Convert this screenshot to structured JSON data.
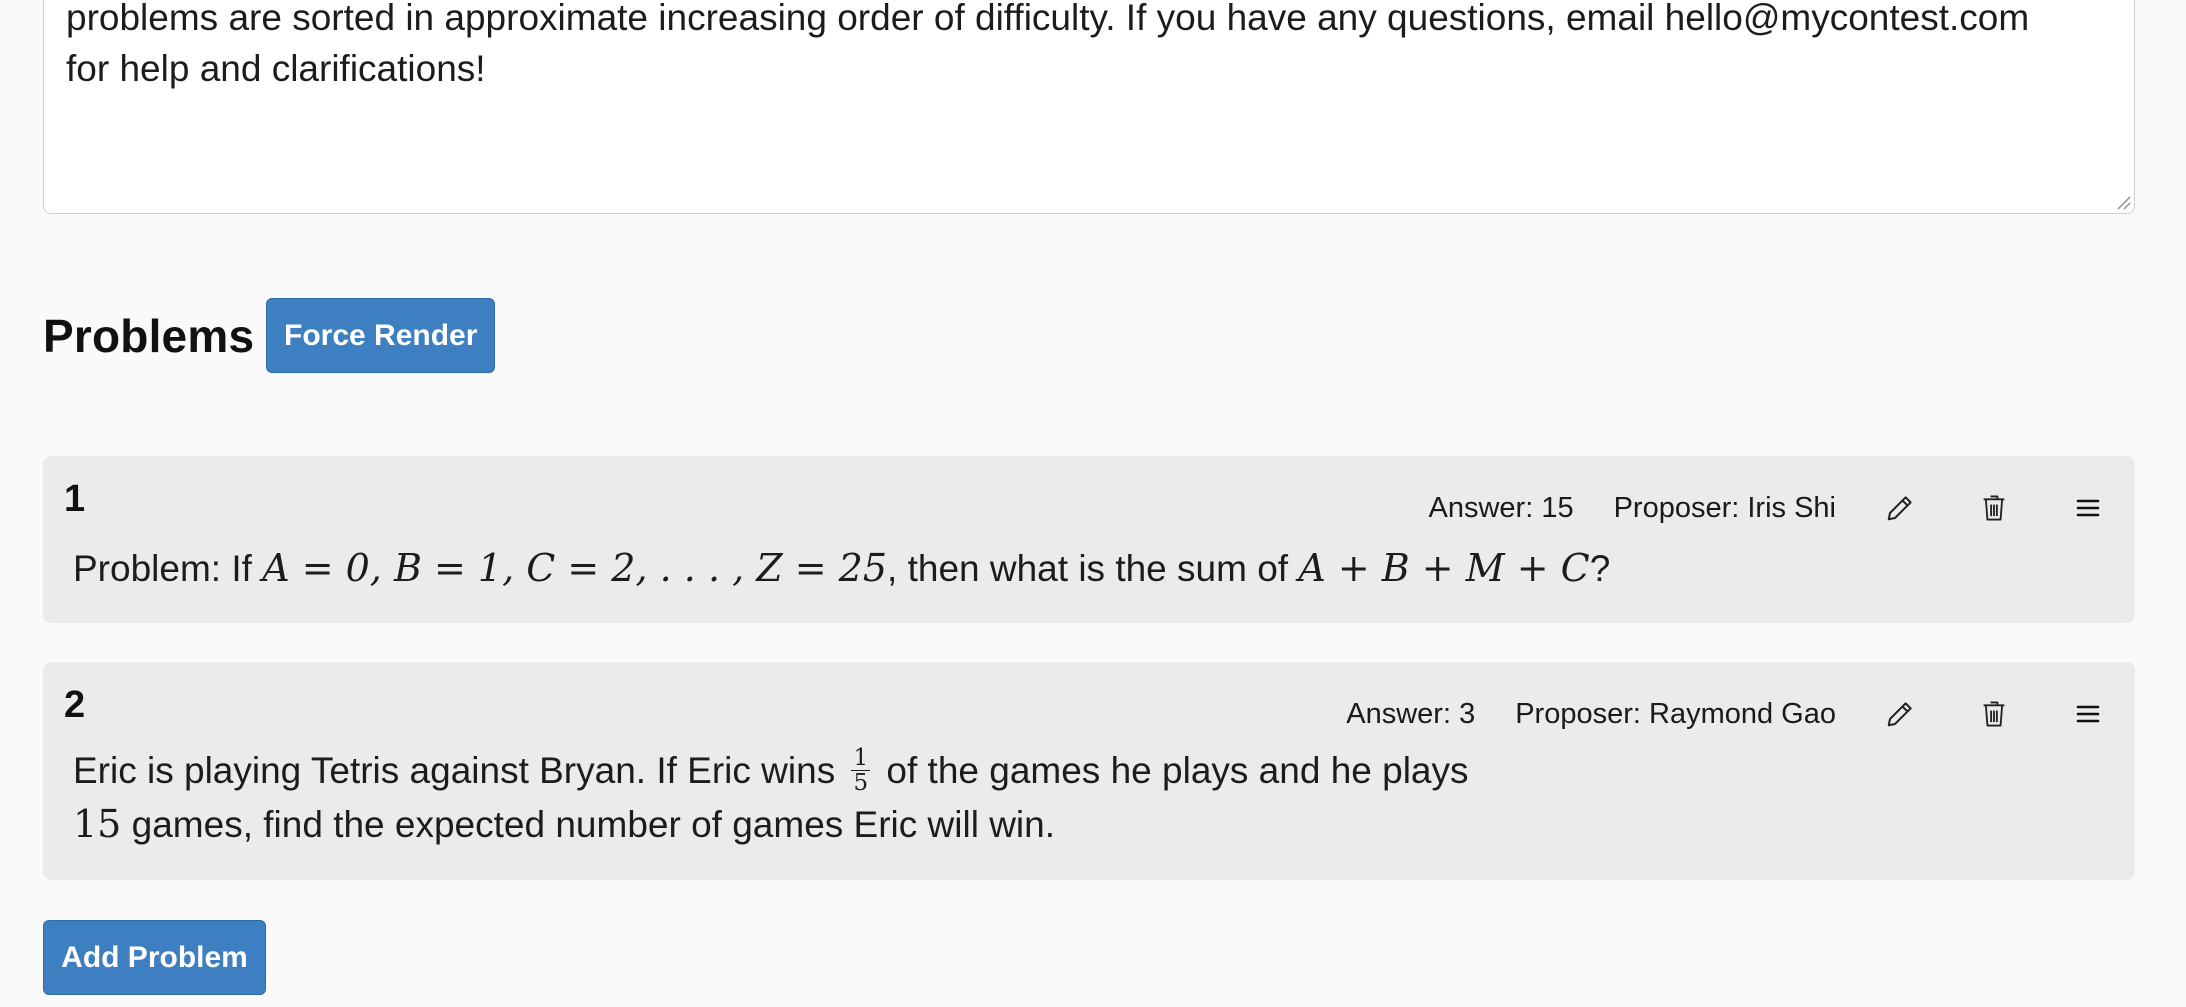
{
  "description": {
    "line1": "problems are sorted in approximate increasing order of difficulty. If you have any questions, email hello@mycontest.com",
    "line2": "for help and clarifications!"
  },
  "problems_section": {
    "title": "Problems",
    "force_render_label": "Force Render",
    "add_problem_label": "Add Problem"
  },
  "problems": [
    {
      "number": "1",
      "answer": "Answer: 15",
      "proposer": "Proposer: Iris Shi",
      "prefix": "Problem: If ",
      "math1": "A = 0, B = 1, C = 2, . . . , Z = 25",
      "mid": ", then what is the sum of ",
      "math2": "A + B + M + C",
      "suffix": "?"
    },
    {
      "number": "2",
      "answer": "Answer: 3",
      "proposer": "Proposer: Raymond Gao",
      "line1_prefix": "Eric is playing Tetris against Bryan. If Eric wins ",
      "frac_num": "1",
      "frac_den": "5",
      "line1_suffix": " of the games he plays and he plays",
      "line2_math": "15",
      "line2_text": " games, find the expected number of games Eric will win."
    }
  ],
  "icons": {
    "edit": "pencil-icon",
    "delete": "trash-icon",
    "reorder": "menu-icon"
  },
  "colors": {
    "button": "#3d7fc1",
    "card_bg": "#ebebeb",
    "page_bg": "#fafafa"
  }
}
